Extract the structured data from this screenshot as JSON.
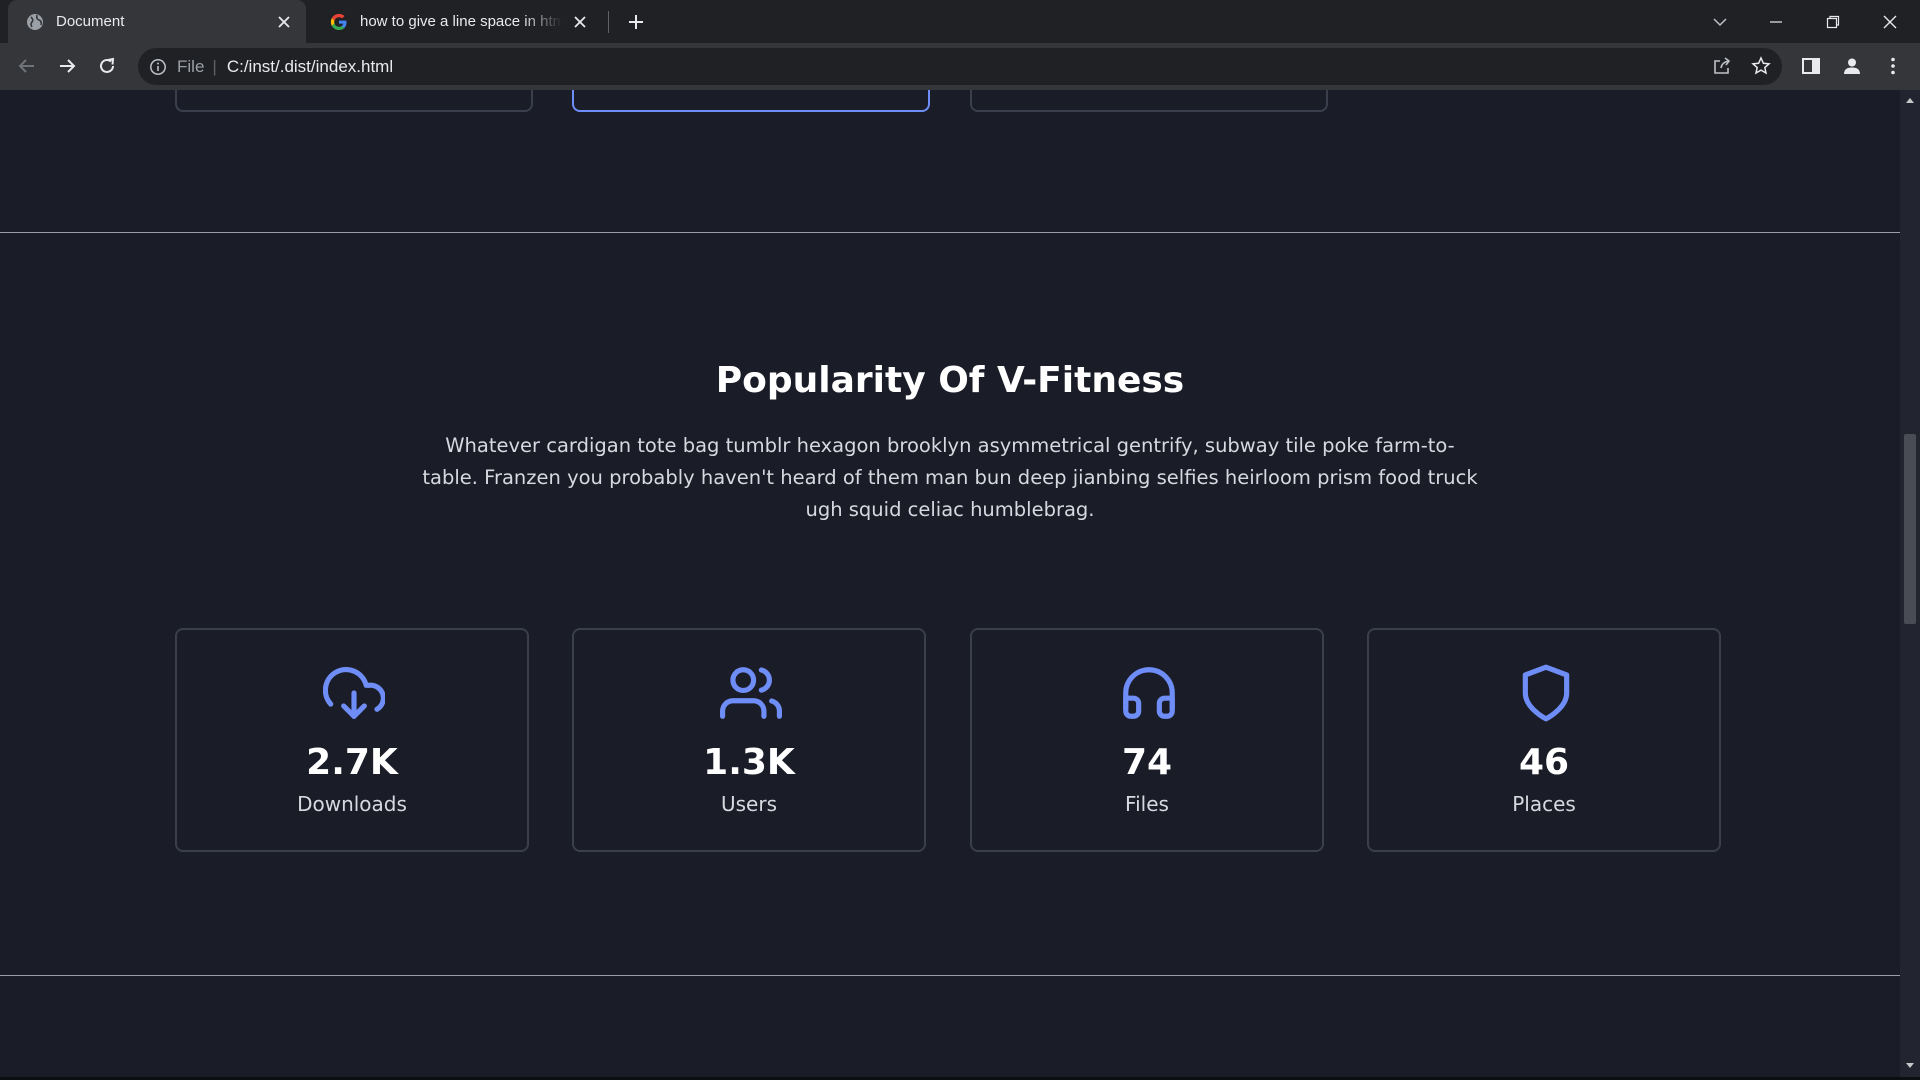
{
  "browser": {
    "tabs": [
      {
        "title": "Document",
        "favicon": "globe-icon",
        "active": true
      },
      {
        "title": "how to give a line space in html - Google Search",
        "favicon": "google-icon",
        "active": false
      }
    ],
    "address": {
      "scheme": "File",
      "url": "C:/inst/.dist/index.html"
    }
  },
  "section": {
    "title": "Popularity Of V-Fitness",
    "description": "Whatever cardigan tote bag tumblr hexagon brooklyn asymmetrical gentrify, subway tile poke farm-to-table. Franzen you probably haven't heard of them man bun deep jianbing selfies heirloom prism food truck ugh squid celiac humblebrag."
  },
  "stats": [
    {
      "icon": "cloud-download-icon",
      "value": "2.7K",
      "label": "Downloads"
    },
    {
      "icon": "users-icon",
      "value": "1.3K",
      "label": "Users"
    },
    {
      "icon": "headphones-icon",
      "value": "74",
      "label": "Files"
    },
    {
      "icon": "shield-icon",
      "value": "46",
      "label": "Places"
    }
  ],
  "colors": {
    "accent": "#6f8df6",
    "background": "#1a1c27",
    "card_border": "#3b3f4d"
  }
}
